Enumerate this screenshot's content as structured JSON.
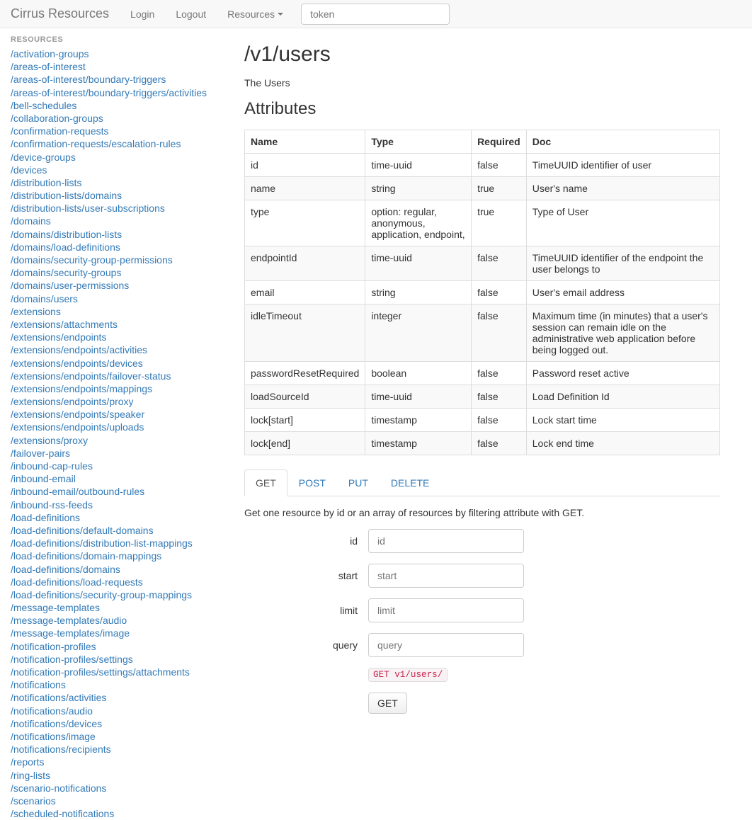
{
  "nav": {
    "brand": "Cirrus Resources",
    "login": "Login",
    "logout": "Logout",
    "resources": "Resources",
    "token_placeholder": "token"
  },
  "sidebar": {
    "heading": "RESOURCES",
    "items": [
      "/activation-groups",
      "/areas-of-interest",
      "/areas-of-interest/boundary-triggers",
      "/areas-of-interest/boundary-triggers/activities",
      "/bell-schedules",
      "/collaboration-groups",
      "/confirmation-requests",
      "/confirmation-requests/escalation-rules",
      "/device-groups",
      "/devices",
      "/distribution-lists",
      "/distribution-lists/domains",
      "/distribution-lists/user-subscriptions",
      "/domains",
      "/domains/distribution-lists",
      "/domains/load-definitions",
      "/domains/security-group-permissions",
      "/domains/security-groups",
      "/domains/user-permissions",
      "/domains/users",
      "/extensions",
      "/extensions/attachments",
      "/extensions/endpoints",
      "/extensions/endpoints/activities",
      "/extensions/endpoints/devices",
      "/extensions/endpoints/failover-status",
      "/extensions/endpoints/mappings",
      "/extensions/endpoints/proxy",
      "/extensions/endpoints/speaker",
      "/extensions/endpoints/uploads",
      "/extensions/proxy",
      "/failover-pairs",
      "/inbound-cap-rules",
      "/inbound-email",
      "/inbound-email/outbound-rules",
      "/inbound-rss-feeds",
      "/load-definitions",
      "/load-definitions/default-domains",
      "/load-definitions/distribution-list-mappings",
      "/load-definitions/domain-mappings",
      "/load-definitions/domains",
      "/load-definitions/load-requests",
      "/load-definitions/security-group-mappings",
      "/message-templates",
      "/message-templates/audio",
      "/message-templates/image",
      "/notification-profiles",
      "/notification-profiles/settings",
      "/notification-profiles/settings/attachments",
      "/notifications",
      "/notifications/activities",
      "/notifications/audio",
      "/notifications/devices",
      "/notifications/image",
      "/notifications/recipients",
      "/reports",
      "/ring-lists",
      "/scenario-notifications",
      "/scenarios",
      "/scheduled-notifications"
    ]
  },
  "main": {
    "title": "/v1/users",
    "description": "The Users",
    "attributes_heading": "Attributes",
    "table": {
      "headers": {
        "name": "Name",
        "type": "Type",
        "required": "Required",
        "doc": "Doc"
      },
      "rows": [
        {
          "name": "id",
          "type": "time-uuid",
          "required": "false",
          "doc": "TimeUUID identifier of user"
        },
        {
          "name": "name",
          "type": "string",
          "required": "true",
          "doc": "User's name"
        },
        {
          "name": "type",
          "type": "option: regular, anonymous, application, endpoint,",
          "required": "true",
          "doc": "Type of User"
        },
        {
          "name": "endpointId",
          "type": "time-uuid",
          "required": "false",
          "doc": "TimeUUID identifier of the endpoint the user belongs to"
        },
        {
          "name": "email",
          "type": "string",
          "required": "false",
          "doc": "User's email address"
        },
        {
          "name": "idleTimeout",
          "type": "integer",
          "required": "false",
          "doc": "Maximum time (in minutes) that a user's session can remain idle on the administrative web application before being logged out."
        },
        {
          "name": "passwordResetRequired",
          "type": "boolean",
          "required": "false",
          "doc": "Password reset active"
        },
        {
          "name": "loadSourceId",
          "type": "time-uuid",
          "required": "false",
          "doc": "Load Definition Id"
        },
        {
          "name": "lock[start]",
          "type": "timestamp",
          "required": "false",
          "doc": "Lock start time"
        },
        {
          "name": "lock[end]",
          "type": "timestamp",
          "required": "false",
          "doc": "Lock end time"
        }
      ]
    },
    "tabs": {
      "get": "GET",
      "post": "POST",
      "put": "PUT",
      "delete": "DELETE"
    },
    "get_panel": {
      "description": "Get one resource by id or an array of resources by filtering attribute with GET.",
      "fields": {
        "id": {
          "label": "id",
          "placeholder": "id"
        },
        "start": {
          "label": "start",
          "placeholder": "start"
        },
        "limit": {
          "label": "limit",
          "placeholder": "limit"
        },
        "query": {
          "label": "query",
          "placeholder": "query"
        }
      },
      "request_preview": "GET v1/users/",
      "submit_label": "GET"
    }
  }
}
